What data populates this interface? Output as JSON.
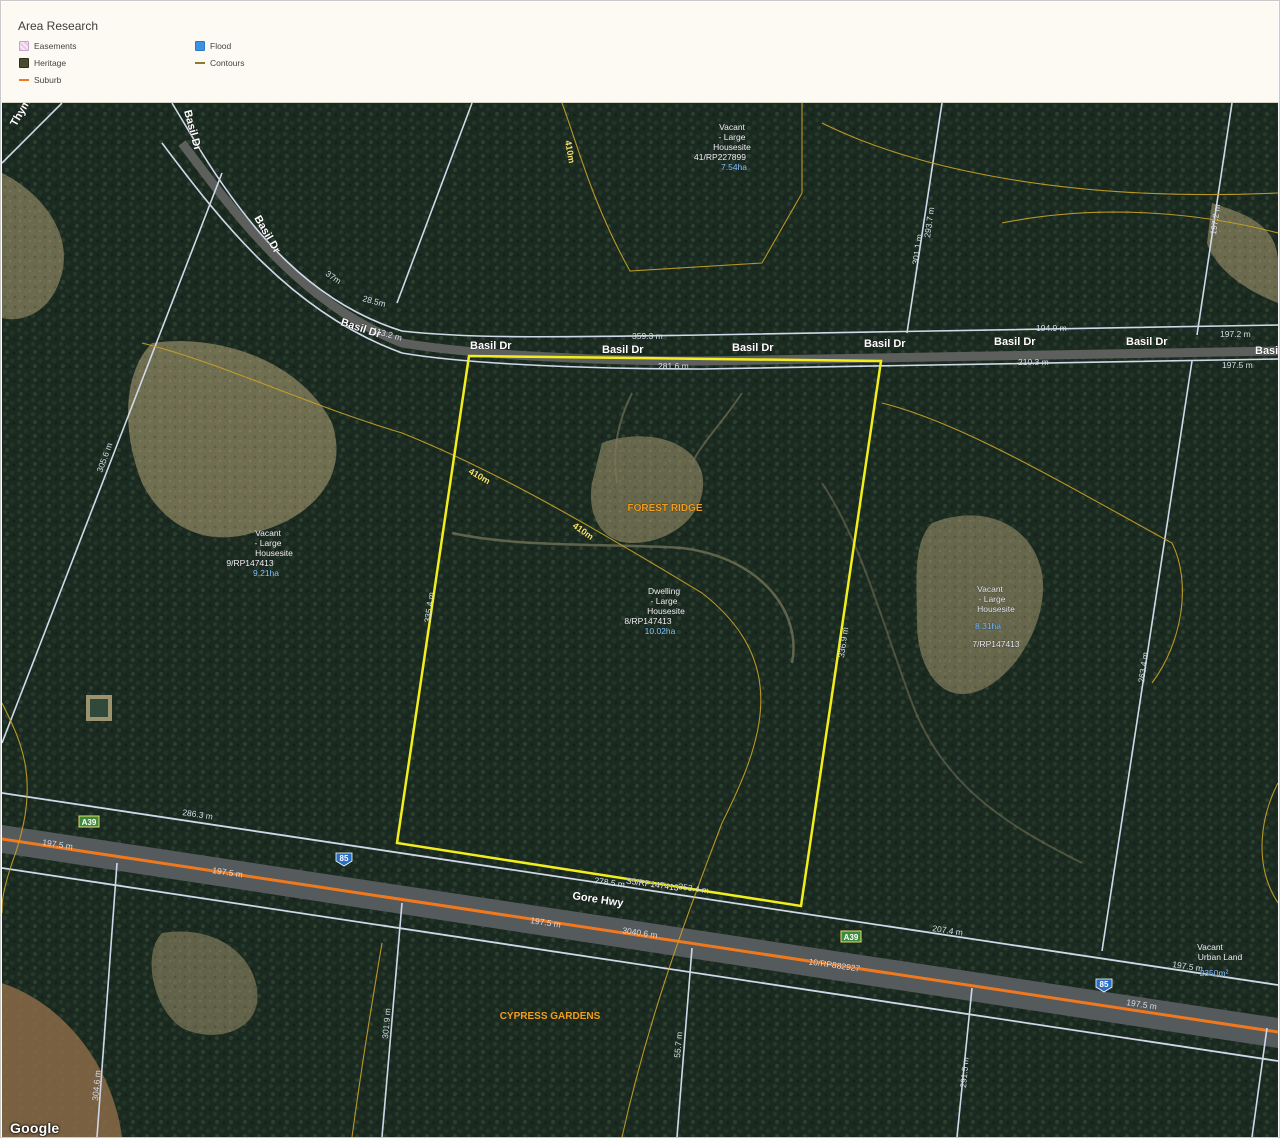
{
  "legend": {
    "title": "Area Research",
    "items": [
      {
        "key": "easements",
        "label": "Easements"
      },
      {
        "key": "flood",
        "label": "Flood",
        "color": "#3b92e0"
      },
      {
        "key": "heritage",
        "label": "Heritage"
      },
      {
        "key": "contours",
        "label": "Contours"
      },
      {
        "key": "suburb",
        "label": "Suburb",
        "color": "#f0781e"
      }
    ]
  },
  "map": {
    "attribution": "Google",
    "colors": {
      "subject_boundary": "#f2ee1e",
      "suburb_line": "#f0781e",
      "contour": "#c9a227",
      "lot_line": "#cfd8e8"
    },
    "streets": [
      {
        "id": "basil-dr-1",
        "name": "Basil Dr"
      },
      {
        "id": "basil-dr-2",
        "name": "Basil Dr"
      },
      {
        "id": "basil-dr-3",
        "name": "Basil Dr"
      },
      {
        "id": "basil-dr-4",
        "name": "Basil Dr"
      },
      {
        "id": "basil-dr-5",
        "name": "Basil Dr"
      },
      {
        "id": "basil-dr-6",
        "name": "Basil Dr"
      },
      {
        "id": "basil-dr-7",
        "name": "Basil"
      },
      {
        "id": "basil-dr-diag",
        "name": "Basil Dr"
      },
      {
        "id": "basil-dr-diag-2",
        "name": "Basil Dr"
      },
      {
        "id": "basil-dr-top",
        "name": "Basil Dr"
      },
      {
        "id": "thyme",
        "name": "Thym"
      },
      {
        "id": "gore-hwy",
        "name": "Gore Hwy"
      }
    ],
    "route_shields": [
      {
        "id": "a39-west",
        "label": "A39"
      },
      {
        "id": "b5-west",
        "label": "85"
      },
      {
        "id": "a39-east",
        "label": "A39"
      },
      {
        "id": "b5-east",
        "label": "85"
      }
    ],
    "suburbs": [
      {
        "id": "forest-ridge",
        "name": "FOREST RIDGE"
      },
      {
        "id": "cypress-gardens",
        "name": "CYPRESS GARDENS"
      }
    ],
    "contours": [
      {
        "id": "c1",
        "label": "410m"
      },
      {
        "id": "c2",
        "label": "410m"
      },
      {
        "id": "c3",
        "label": "410m"
      }
    ],
    "dimensions": [
      {
        "id": "d1",
        "label": "281.6 m"
      },
      {
        "id": "d2",
        "label": "359.3 m"
      },
      {
        "id": "d3",
        "label": "194.9 m"
      },
      {
        "id": "d4",
        "label": "210.3 m"
      },
      {
        "id": "d5",
        "label": "197.5 m"
      },
      {
        "id": "d6",
        "label": "197.2 m"
      },
      {
        "id": "d7",
        "label": "28.5m"
      },
      {
        "id": "d8",
        "label": "37m"
      },
      {
        "id": "d9",
        "label": "113.2 m"
      },
      {
        "id": "d10",
        "label": "278.5 m"
      },
      {
        "id": "d11",
        "label": "353.4 m"
      },
      {
        "id": "d12",
        "label": "286.3 m"
      },
      {
        "id": "d13",
        "label": "197.5 m"
      },
      {
        "id": "d14",
        "label": "197.5 m"
      },
      {
        "id": "d15",
        "label": "197.5 m"
      },
      {
        "id": "d16",
        "label": "3040.6 m"
      },
      {
        "id": "d17",
        "label": "207.4 m"
      },
      {
        "id": "d18",
        "label": "197.5 m"
      },
      {
        "id": "d19",
        "label": "197.5 m"
      },
      {
        "id": "d20",
        "label": "335.4 m"
      },
      {
        "id": "d21",
        "label": "336.9 m"
      },
      {
        "id": "d22",
        "label": "305.6 m"
      },
      {
        "id": "d23",
        "label": "263.4 m"
      },
      {
        "id": "d24",
        "label": "301.1 m"
      },
      {
        "id": "d25",
        "label": "293.7 m"
      },
      {
        "id": "d26",
        "label": "197.2 m"
      },
      {
        "id": "d27",
        "label": "304.6 m"
      },
      {
        "id": "d28",
        "label": "301.9 m"
      },
      {
        "id": "d29",
        "label": "55.7 m"
      },
      {
        "id": "d30",
        "label": "291.5 m"
      }
    ],
    "lots": [
      {
        "id": "lot-41",
        "use": [
          "Vacant",
          "- Large",
          "Housesite"
        ],
        "lotplan": "41/RP227899",
        "area": "7.54ha"
      },
      {
        "id": "lot-9",
        "use": [
          "Vacant",
          "- Large",
          "Housesite"
        ],
        "lotplan": "9/RP147413",
        "area": "9.21ha"
      },
      {
        "id": "lot-8",
        "use": [
          "Dwelling",
          "- Large",
          "Housesite"
        ],
        "lotplan": "8/RP147413",
        "area": "10.02ha"
      },
      {
        "id": "lot-7",
        "use": [
          "Vacant",
          "- Large",
          "Housesite"
        ],
        "lotplan": "7/RP147413",
        "area": "8.31ha"
      },
      {
        "id": "lot-10",
        "use": [],
        "lotplan": "10/RP882927",
        "area": ""
      },
      {
        "id": "lot-urban",
        "use": [
          "Vacant",
          "Urban Land"
        ],
        "lotplan": "",
        "area": "2350m²"
      },
      {
        "id": "lot-s5",
        "use": [],
        "lotplan": "S5/RP147413",
        "area": ""
      }
    ]
  }
}
